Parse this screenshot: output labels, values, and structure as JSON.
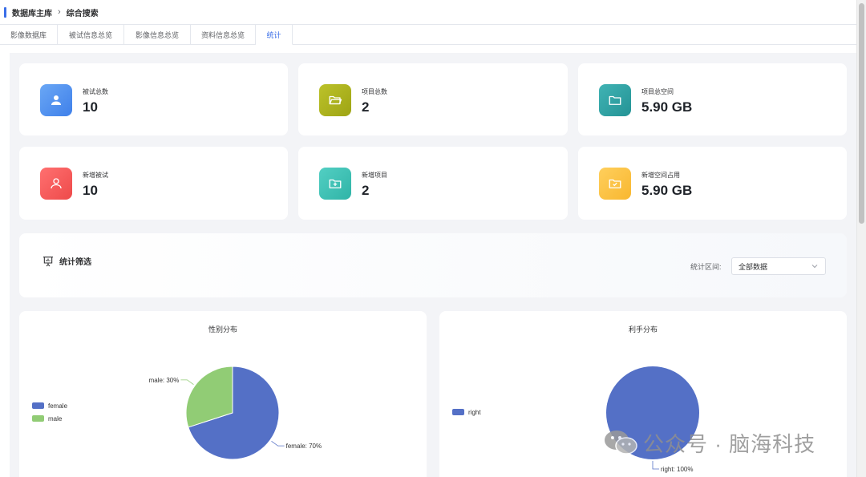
{
  "breadcrumb": {
    "root": "数据库主库",
    "separator": "›",
    "current": "综合搜索"
  },
  "tabs": [
    {
      "label": "影像数据库",
      "active": false
    },
    {
      "label": "被试信息总览",
      "active": false
    },
    {
      "label": "影像信息总览",
      "active": false
    },
    {
      "label": "资料信息总览",
      "active": false
    },
    {
      "label": "统计",
      "active": true
    }
  ],
  "stats": [
    {
      "label": "被试总数",
      "value": "10",
      "icon": "user-icon",
      "color": "#4f8ff0"
    },
    {
      "label": "项目总数",
      "value": "2",
      "icon": "folder-open-icon",
      "color": "#aab21a"
    },
    {
      "label": "项目总空间",
      "value": "5.90 GB",
      "icon": "folder-icon",
      "color": "#2fa3a5"
    },
    {
      "label": "新增被试",
      "value": "10",
      "icon": "user-add-icon",
      "color": "#f25a5a"
    },
    {
      "label": "新增项目",
      "value": "2",
      "icon": "folder-plus-icon",
      "color": "#3ec1b4"
    },
    {
      "label": "新增空间占用",
      "value": "5.90 GB",
      "icon": "folder-check-icon",
      "color": "#fbc142"
    }
  ],
  "filter": {
    "title": "统计筛选",
    "range_label": "统计区间:",
    "range_value": "全部数据"
  },
  "chart_data": [
    {
      "type": "pie",
      "title": "性别分布",
      "series": [
        {
          "name": "female",
          "value": 70,
          "label": "female: 70%",
          "color": "#5470c6"
        },
        {
          "name": "male",
          "value": 30,
          "label": "male: 30%",
          "color": "#91cc75"
        }
      ],
      "legend": "left"
    },
    {
      "type": "pie",
      "title": "利手分布",
      "series": [
        {
          "name": "right",
          "value": 100,
          "label": "right: 100%",
          "color": "#5470c6"
        }
      ],
      "legend": "left"
    }
  ],
  "watermark": {
    "text": "公众号 · 脑海科技",
    "icon": "wechat-icon"
  }
}
